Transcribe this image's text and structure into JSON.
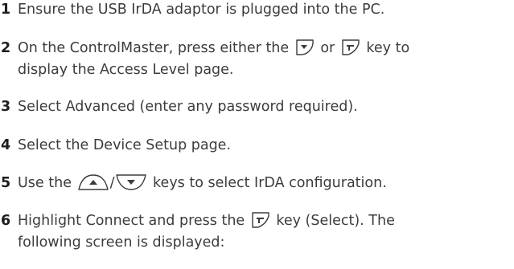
{
  "steps": [
    {
      "number": "1",
      "text": "Ensure the USB IrDA adaptor is plugged into the PC."
    },
    {
      "number": "2",
      "line1_before": "On the ControlMaster, press either the",
      "line1_icon1": "menu-down-key-icon",
      "line1_mid": "or",
      "line1_icon2": "enter-select-key-icon",
      "line1_after": "key to",
      "line2": "display the Access Level page."
    },
    {
      "number": "3",
      "text": "Select Advanced (enter any password required)."
    },
    {
      "number": "4",
      "text": "Select the Device Setup page."
    },
    {
      "number": "5",
      "before": "Use the",
      "icon_up": "up-arrow-key-icon",
      "separator": "/",
      "icon_down": "down-arrow-key-icon",
      "after": "keys to select IrDA configuration."
    },
    {
      "number": "6",
      "line1_before": "Highlight Connect and press the",
      "line1_icon": "enter-select-key-icon",
      "line1_after": "key (Select). The",
      "line2": "following screen is displayed:"
    }
  ],
  "icon_color": "#3c3c3c"
}
